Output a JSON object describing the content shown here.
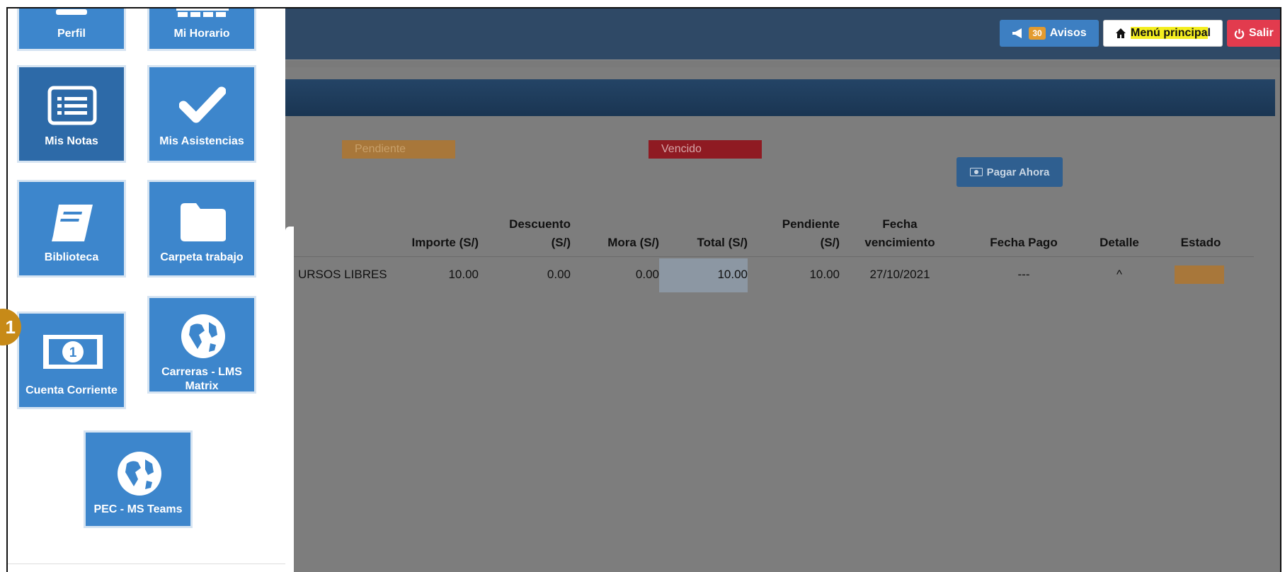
{
  "header": {
    "avisos_count": "30",
    "avisos_label": "Avisos",
    "menu_label_a": "Menú principa",
    "menu_label_b": "l",
    "salir_label": "Salir"
  },
  "legend": {
    "pending": "Pendiente",
    "overdue": "Vencido"
  },
  "pay_button": "Pagar Ahora",
  "table": {
    "headers": {
      "importe": "Importe (S/)",
      "descuento_1": "Descuento",
      "descuento_2": "(S/)",
      "mora": "Mora (S/)",
      "total": "Total (S/)",
      "pendiente_1": "Pendiente",
      "pendiente_2": "(S/)",
      "fecha_venc_1": "Fecha",
      "fecha_venc_2": "vencimiento",
      "fecha_pago": "Fecha Pago",
      "detalle": "Detalle",
      "estado": "Estado"
    },
    "row": {
      "concepto": "URSOS LIBRES",
      "importe": "10.00",
      "descuento": "0.00",
      "mora": "0.00",
      "total": "10.00",
      "pendiente": "10.00",
      "fecha_vencimiento": "27/10/2021",
      "fecha_pago": "---",
      "detalle": "^"
    }
  },
  "drawer": {
    "tiles": {
      "perfil": "Perfil",
      "horario": "Mi Horario",
      "notas": "Mis Notas",
      "asistencias": "Mis Asistencias",
      "biblioteca": "Biblioteca",
      "carpeta": "Carpeta trabajo",
      "cuenta": "Cuenta Corriente",
      "carreras_1": "Carreras - LMS",
      "carreras_2": "Matrix",
      "pec": "PEC - MS Teams"
    },
    "icons": [
      "profile-icon",
      "calendar-icon",
      "list-icon",
      "check-icon",
      "book-icon",
      "folder-icon",
      "money-icon",
      "globe-icon",
      "globe-icon"
    ]
  },
  "step_marker": "1",
  "colors": {
    "tile_blue": "#3d86cc",
    "topbar": "#2f4966",
    "pending": "#e39b2f",
    "overdue": "#c0182a",
    "salir": "#e23b4e",
    "marker": "#c78a18"
  }
}
